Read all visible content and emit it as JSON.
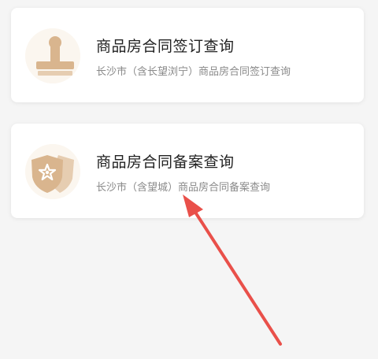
{
  "cards": [
    {
      "title": "商品房合同签订查询",
      "subtitle": "长沙市（含长望浏宁）商品房合同签订查询",
      "icon": "stamp-icon"
    },
    {
      "title": "商品房合同备案查询",
      "subtitle": "长沙市（含望城）商品房合同备案查询",
      "icon": "shield-star-icon"
    }
  ],
  "colors": {
    "icon_tan": "#d9b58e",
    "icon_bg": "#fbf6ef",
    "arrow_red": "#e9504a",
    "title": "#222222",
    "subtitle": "#8a8a8a"
  }
}
